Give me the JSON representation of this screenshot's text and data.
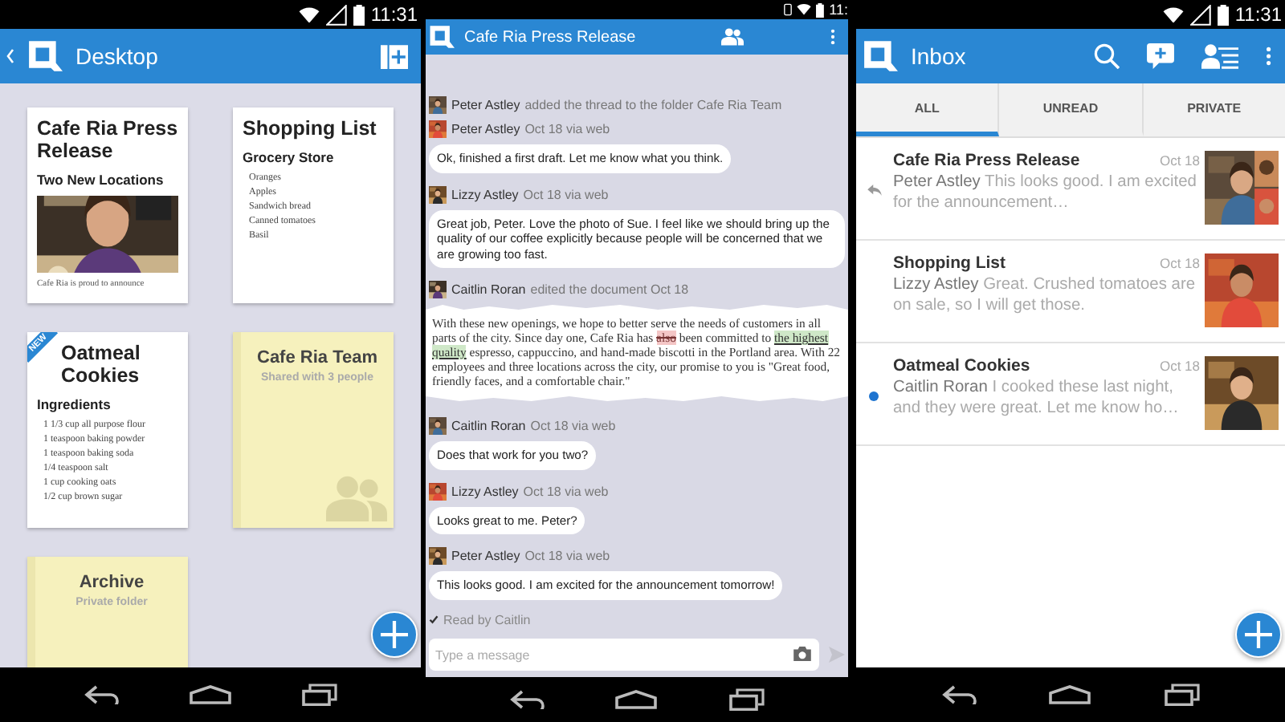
{
  "desktop": {
    "status_time": "11:31",
    "title": "Desktop",
    "cards": [
      {
        "kind": "document",
        "title": "Cafe Ria Press Release",
        "subtitle": "Two New Locations",
        "has_photo": true,
        "body": "Cafe Ria is proud to announce"
      },
      {
        "kind": "document",
        "title": "Shopping List",
        "subtitle": "Grocery Store",
        "items": [
          "Oranges",
          "Apples",
          "Sandwich bread",
          "Canned tomatoes",
          "Basil"
        ]
      },
      {
        "kind": "document",
        "title": "Oatmeal Cookies",
        "badge": "NEW",
        "subtitle": "Ingredients",
        "items": [
          "1 1/3 cup all purpose flour",
          "1 teaspoon baking powder",
          "1 teaspoon baking soda",
          "1/4 teaspoon salt",
          "1 cup cooking oats",
          "1/2 cup brown sugar"
        ]
      },
      {
        "kind": "folder",
        "title": "Cafe Ria Team",
        "subtitle": "Shared with 3 people",
        "shared": true
      },
      {
        "kind": "folder",
        "title": "Archive",
        "subtitle": "Private folder",
        "shared": false
      }
    ]
  },
  "thread": {
    "status_time": "11:",
    "title": "Cafe Ria Press Release",
    "events": [
      {
        "kind": "activity",
        "author": "Peter Astley",
        "text": "added the thread to the folder Cafe Ria Team"
      },
      {
        "kind": "message",
        "author": "Peter Astley",
        "meta": "Oct 18 via web",
        "text": "Ok, finished a first draft. Let me know what you think."
      },
      {
        "kind": "message",
        "author": "Lizzy Astley",
        "meta": "Oct 18 via web",
        "text": "Great job, Peter. Love the photo of Sue. I feel like we should bring up the quality of our coffee explicitly because people will be concerned that we are growing too fast."
      },
      {
        "kind": "activity",
        "author": "Caitlin Roran",
        "text": "edited the document Oct 18"
      },
      {
        "kind": "excerpt",
        "segments": [
          {
            "text": "With these new openings, we hope to better serve the needs of customers in all parts of the city. Since day one, Cafe Ria has ",
            "kind": "plain"
          },
          {
            "text": "also",
            "kind": "deleted"
          },
          {
            "text": " been committed to ",
            "kind": "plain"
          },
          {
            "text": "the highest quality",
            "kind": "inserted"
          },
          {
            "text": " espresso, cappuccino, and hand-made biscotti in the Portland area. With 22 employees and three locations across the city, our promise to you is \"Great food, friendly faces, and a comfortable chair.\"",
            "kind": "plain"
          }
        ]
      },
      {
        "kind": "message",
        "author": "Caitlin Roran",
        "meta": "Oct 18 via web",
        "text": "Does that work for you two?"
      },
      {
        "kind": "message",
        "author": "Lizzy Astley",
        "meta": "Oct 18 via web",
        "text": "Looks great to me. Peter?"
      },
      {
        "kind": "message",
        "author": "Peter Astley",
        "meta": "Oct 18 via web",
        "text": "This looks good. I am excited for the announcement tomorrow!"
      }
    ],
    "read_receipt": "Read by Caitlin",
    "composer": {
      "placeholder": "Type a message"
    }
  },
  "inbox": {
    "status_time": "11:31",
    "title": "Inbox",
    "tabs": [
      {
        "label": "ALL",
        "selected": true
      },
      {
        "label": "UNREAD",
        "selected": false
      },
      {
        "label": "PRIVATE",
        "selected": false
      }
    ],
    "conversations": [
      {
        "title": "Cafe Ria Press Release",
        "date": "Oct 18",
        "author": "Peter Astley",
        "preview": "This looks good. I am excited for the announcement…",
        "replied": true,
        "unread": false
      },
      {
        "title": "Shopping List",
        "date": "Oct 18",
        "author": "Lizzy Astley",
        "preview": "Great. Crushed tomatoes are on sale, so I will get those.",
        "replied": false,
        "unread": false
      },
      {
        "title": "Oatmeal Cookies",
        "date": "Oct 18",
        "author": "Caitlin Roran",
        "preview": "I cooked these last night, and they were great. Let me know ho…",
        "replied": false,
        "unread": true
      }
    ]
  }
}
